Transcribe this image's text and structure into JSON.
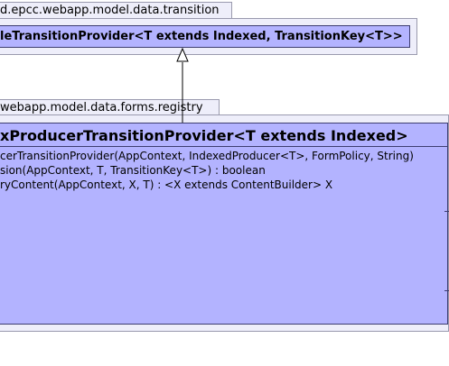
{
  "upper_package": {
    "name": "d.epcc.webapp.model.data.transition",
    "class": {
      "title": "leTransitionProvider<T extends Indexed, TransitionKey<T>>"
    }
  },
  "lower_package": {
    "name": "webapp.model.data.forms.registry",
    "class": {
      "title": "xProducerTransitionProvider<T extends Indexed>",
      "members": [
        "cerTransitionProvider(AppContext, IndexedProducer<T>, FormPolicy, String)",
        "sion(AppContext, T, TransitionKey<T>) : boolean",
        "ryContent(AppContext, X, T) : <X extends ContentBuilder> X"
      ]
    }
  },
  "relationship": {
    "type": "generalization",
    "arrowhead": "hollow-triangle"
  },
  "colors": {
    "package_fill": "#eeeefa",
    "package_border": "#9a9aae",
    "class_fill": "#b3b3ff",
    "class_border": "#3d3d70"
  }
}
